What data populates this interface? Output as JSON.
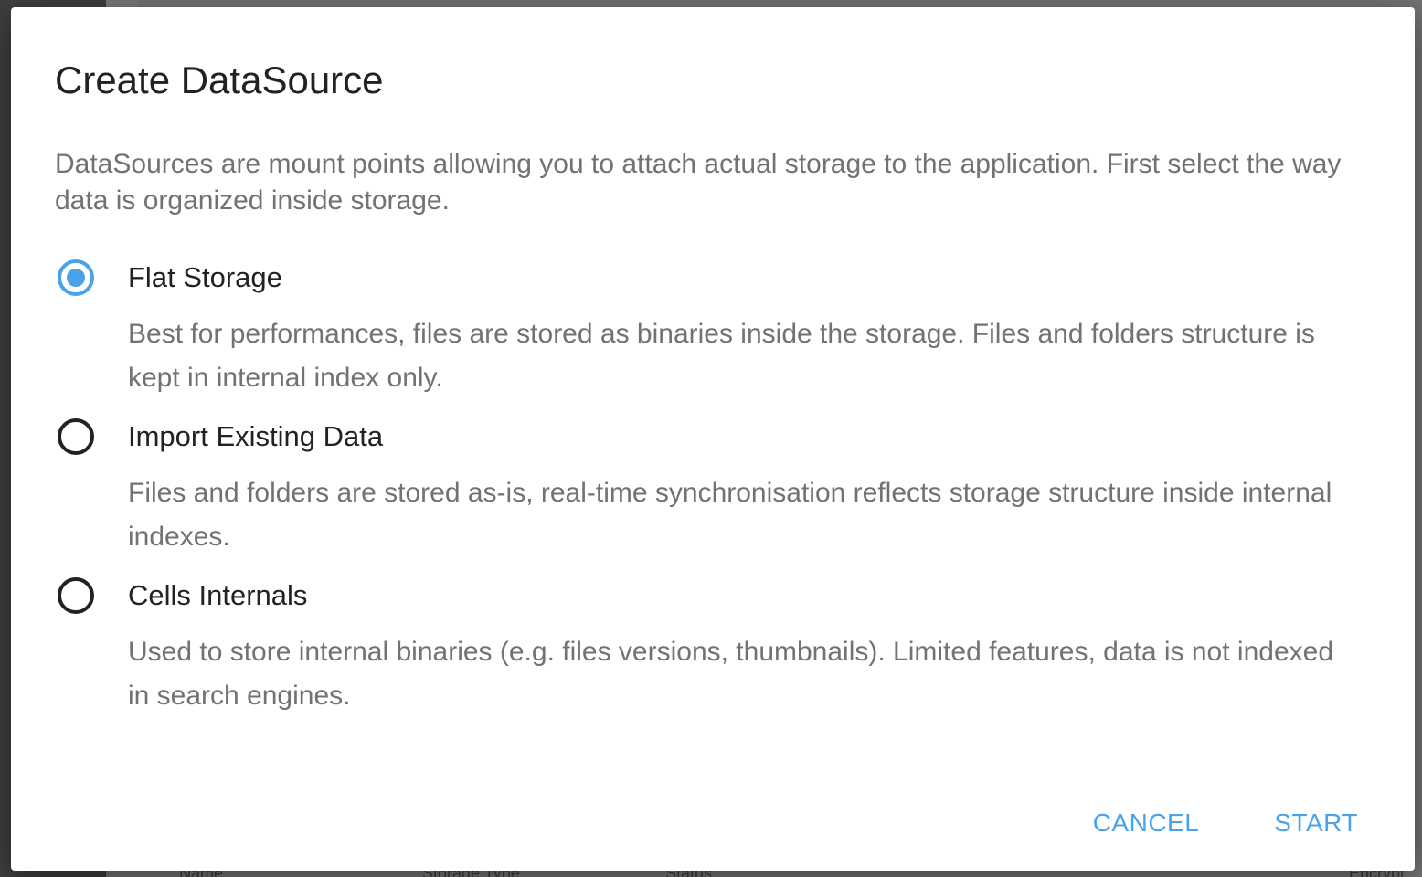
{
  "dialog": {
    "title": "Create DataSource",
    "description": "DataSources are mount points allowing you to attach actual storage to the application. First select the way data is organized inside storage.",
    "options": [
      {
        "label": "Flat Storage",
        "description": "Best for performances, files are stored as binaries inside the storage. Files and folders structure is kept in internal index only.",
        "selected": true
      },
      {
        "label": "Import Existing Data",
        "description": "Files and folders are stored as-is, real-time synchronisation reflects storage structure inside internal indexes.",
        "selected": false
      },
      {
        "label": "Cells Internals",
        "description": "Used to store internal binaries (e.g. files versions, thumbnails). Limited features, data is not indexed in search engines.",
        "selected": false
      }
    ],
    "actions": {
      "cancel_label": "CANCEL",
      "start_label": "START"
    }
  },
  "background": {
    "table_headers": [
      "Name",
      "Storage Type",
      "Status",
      "Encrypt"
    ]
  },
  "colors": {
    "accent": "#4aa3e8",
    "title_text": "#222222",
    "body_text": "#727272",
    "backdrop": "#737373"
  }
}
